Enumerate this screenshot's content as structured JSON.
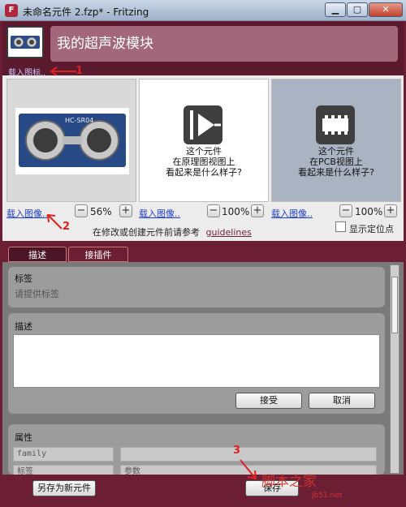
{
  "window": {
    "title": "未命名元件 2.fzp* - Fritzing",
    "app_icon_letter": "F",
    "controls": {
      "minimize": "▁",
      "maximize": "▢",
      "close": "✕"
    }
  },
  "header": {
    "part_name": "我的超声波模块",
    "load_image_link": "载入图标..",
    "annotation_1": "1"
  },
  "views": {
    "breadboard": {
      "load_link": "载入图像..",
      "zoom": "56%",
      "annotation": "2"
    },
    "schematic": {
      "caption_line1": "这个元件",
      "caption_line2": "在原理图视图上",
      "caption_line3": "看起来是什么样子?",
      "load_link": "载入图像..",
      "zoom": "100%"
    },
    "pcb": {
      "caption_line1": "这个元件",
      "caption_line2": "在PCB视图上",
      "caption_line3": "看起来是什么样子?",
      "load_link": "载入图像..",
      "zoom": "100%"
    },
    "hint_text": "在修改或创建元件前请参考",
    "hint_link": "guidelines",
    "show_anchor_label": "显示定位点",
    "zoom_minus": "−",
    "zoom_plus": "+",
    "sensor_label": "HC-SR04"
  },
  "tabs": [
    {
      "label": "描述",
      "active": true
    },
    {
      "label": "接插件",
      "active": false
    }
  ],
  "panel": {
    "label_section": {
      "title": "标签",
      "placeholder": "请提供标签"
    },
    "description_section": {
      "title": "描述",
      "accept_label": "接受",
      "cancel_label": "取消"
    },
    "properties_section": {
      "title": "属性",
      "field1": "family",
      "row2_name": "标签",
      "row2_value": "参数"
    }
  },
  "footer": {
    "save_as_new_label": "另存为新元件",
    "save_label": "保存",
    "annotation_3": "3"
  },
  "watermark": {
    "text": "脚本之家",
    "sub": "jb51.net"
  },
  "colors": {
    "accent": "#6b1e34",
    "name_field": "#a2677a",
    "link": "#1f3fcf",
    "annotation": "#e02020"
  }
}
